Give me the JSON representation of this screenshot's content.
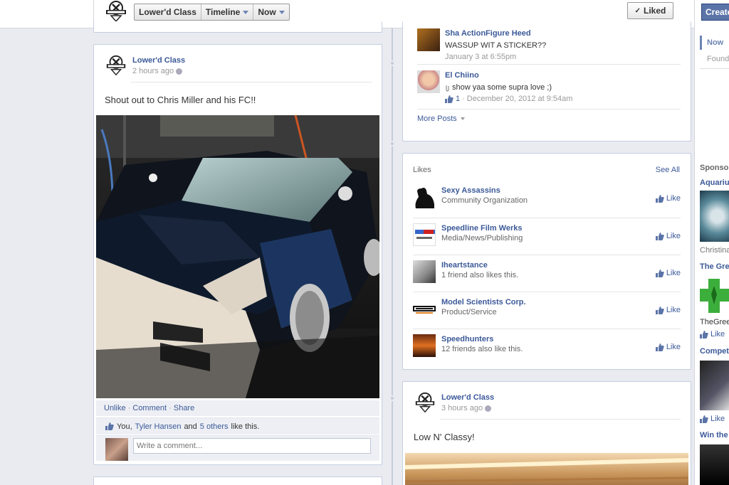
{
  "header": {
    "crumbs": [
      {
        "label": "Lower'd Class",
        "has_caret": false
      },
      {
        "label": "Timeline",
        "has_caret": true
      },
      {
        "label": "Now",
        "has_caret": true
      }
    ],
    "liked_label": "Liked",
    "liked_check": "✓"
  },
  "left_post": {
    "author": "Lower'd Class",
    "time": "2 hours ago",
    "text": "Shout out to Chris Miller and his FC!!",
    "actions": {
      "unlike": "Unlike",
      "comment": "Comment",
      "share": "Share",
      "sep": "·"
    },
    "likes": {
      "you": "You,",
      "friend": "Tyler Hansen",
      "and": "and",
      "others": "5 others",
      "suffix": "like this."
    },
    "comment_placeholder": "Write a comment..."
  },
  "recent_posts": {
    "items": [
      {
        "author": "Sha ActionFigure Heed",
        "text": "WASSUP WIT A STICKER??",
        "time": "January 3 at 6:55pm",
        "likes": ""
      },
      {
        "author": "El Chiino",
        "text": "show yaa some supra love ;)",
        "time": "December 20, 2012 at 9:54am",
        "likes": "1"
      }
    ],
    "sep": "·",
    "more_posts": "More Posts"
  },
  "likes_box": {
    "title": "Likes",
    "see_all": "See All",
    "like_label": "Like",
    "items": [
      {
        "name": "Sexy Assassins",
        "sub": "Community Organization"
      },
      {
        "name": "Speedline Film Werks",
        "sub": "Media/News/Publishing"
      },
      {
        "name": "Iheartstance",
        "sub": "1 friend also likes this."
      },
      {
        "name": "Model Scientists Corp.",
        "sub": "Product/Service"
      },
      {
        "name": "Speedhunters",
        "sub": "12 friends also like this."
      }
    ]
  },
  "right_post": {
    "author": "Lower'd Class",
    "time": "3 hours ago",
    "text": "Low N' Classy!"
  },
  "sidebar": {
    "create": "Create",
    "now": "Now",
    "founded": "Found",
    "sponsored": "Sponso",
    "ad1_title": "Aquariu",
    "ad1_caption": "Christina",
    "ad2_title": "The Gre",
    "ad2_caption": "TheGreen",
    "like": "Like",
    "ad3_title": "Compet",
    "ad4_title": "Win the"
  },
  "colors": {
    "fb_blue": "#3b5998",
    "bg": "#e9ebf0",
    "card_border": "#c4cde0"
  }
}
